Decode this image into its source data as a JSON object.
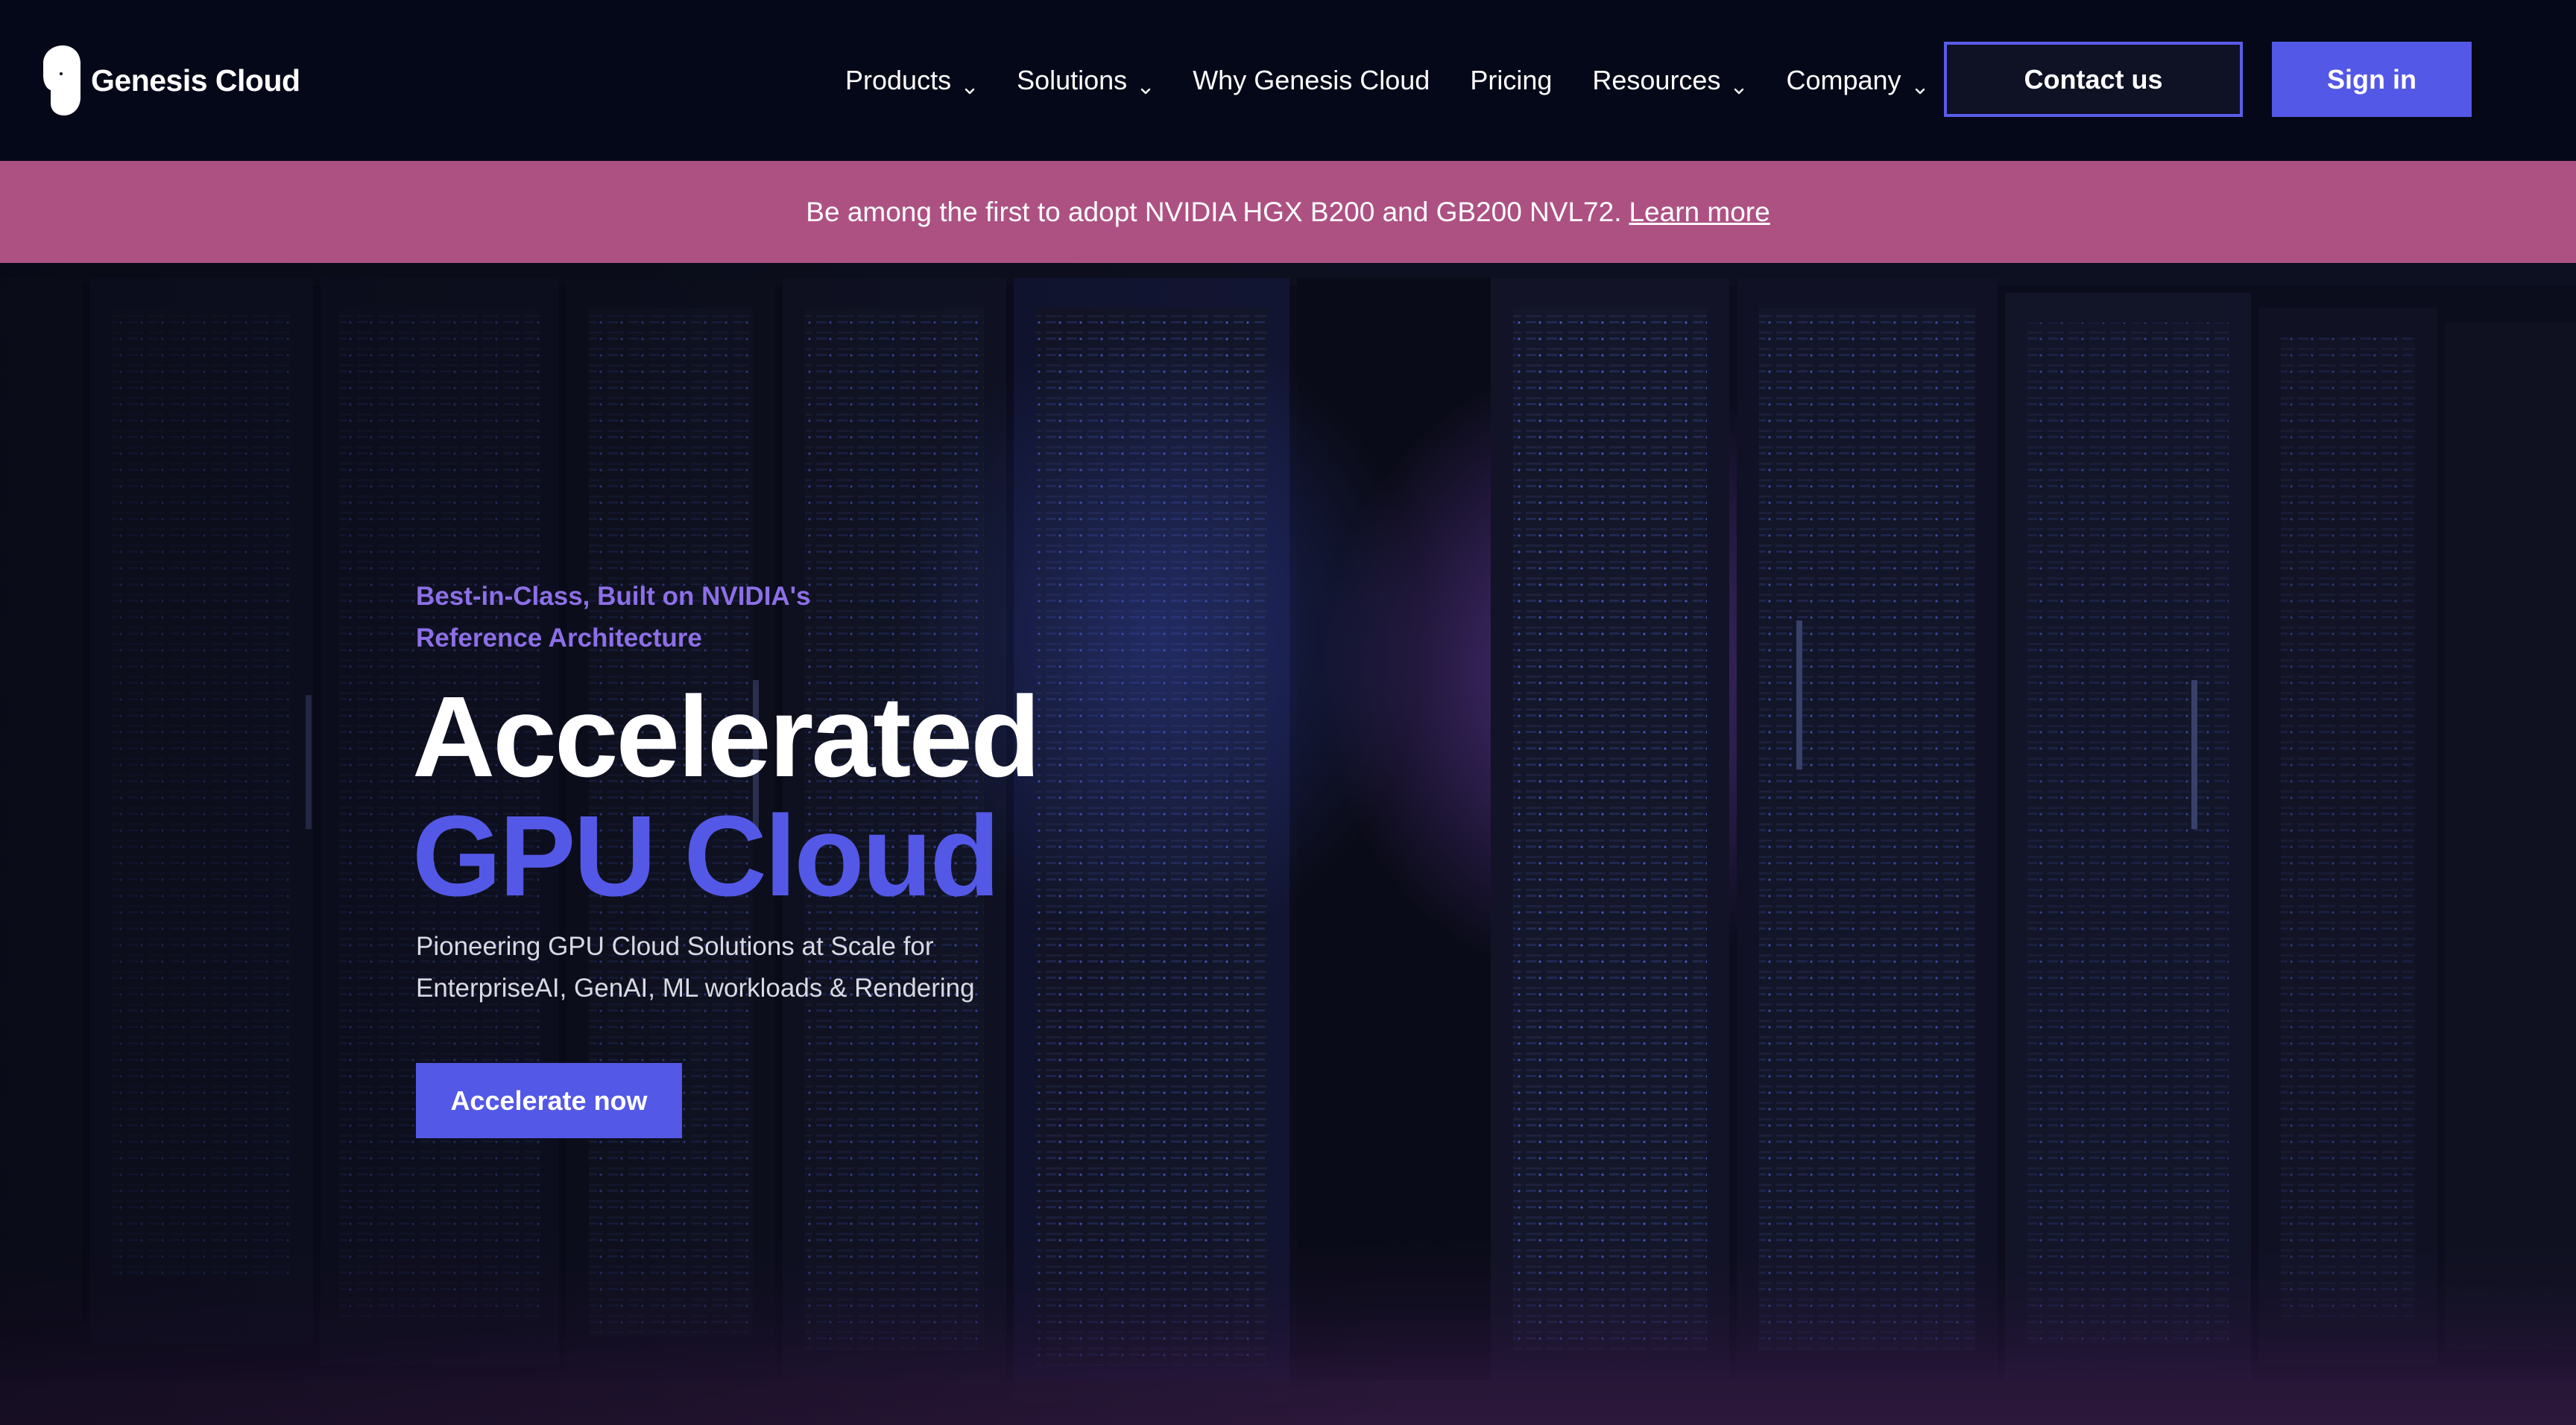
{
  "nav": {
    "logo_text": "Genesis Cloud",
    "items": [
      {
        "label": "Products",
        "has_dropdown": true
      },
      {
        "label": "Solutions",
        "has_dropdown": true
      },
      {
        "label": "Why Genesis Cloud",
        "has_dropdown": false
      },
      {
        "label": "Pricing",
        "has_dropdown": false
      },
      {
        "label": "Resources",
        "has_dropdown": true
      },
      {
        "label": "Company",
        "has_dropdown": true
      }
    ],
    "contact_label": "Contact us",
    "signin_label": "Sign in"
  },
  "banner": {
    "text": "Be among the first to adopt NVIDIA HGX B200 and GB200 NVL72.",
    "link_label": "Learn more"
  },
  "hero": {
    "eyebrow": "Best-in-Class, Built on NVIDIA's Reference Architecture",
    "headline_line1": "Accelerated",
    "headline_line2": "GPU Cloud",
    "subtext": "Pioneering GPU Cloud Solutions at Scale for EnterpriseAI, GenAI, ML workloads & Rendering",
    "cta_label": "Accelerate now",
    "background": "server-racks-image"
  },
  "colors": {
    "nav_bg": "#050818",
    "banner_bg": "#ad5183",
    "accent": "#5458e6",
    "eyebrow": "#8d6fe6",
    "contact_border": "#5a5ce8"
  }
}
